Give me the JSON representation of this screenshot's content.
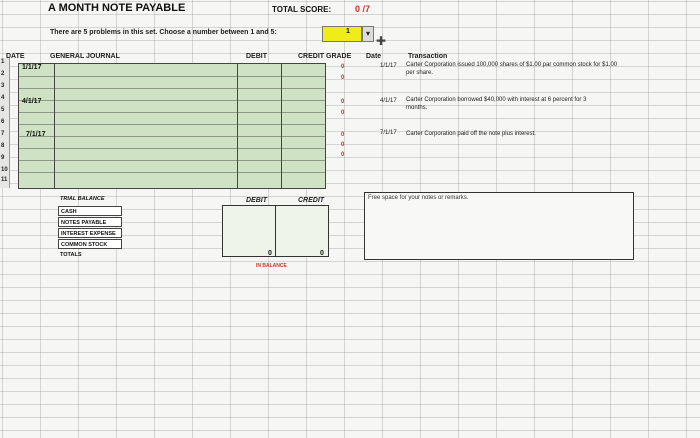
{
  "header": {
    "title": "A MONTH NOTE PAYABLE",
    "total_score_label": "TOTAL SCORE:",
    "total_score_value": "0 /7",
    "instructions": "There are 5 problems in this set. Choose a number between 1 and 5:",
    "problem_selected": "1"
  },
  "journal": {
    "col_date": "DATE",
    "col_journal": "GENERAL JOURNAL",
    "col_debit": "DEBIT",
    "col_credit": "CREDIT",
    "col_grade": "GRADE",
    "entry_dates": [
      "1/1/17",
      "4/1/17",
      "7/1/17"
    ],
    "grades": [
      "0",
      "0",
      "0",
      "0",
      "0",
      "0",
      "0"
    ]
  },
  "row_numbers": [
    "1",
    "2",
    "3",
    "4",
    "5",
    "6",
    "7",
    "8",
    "9",
    "10",
    "11"
  ],
  "transactions": {
    "col_date": "Date",
    "col_transaction": "Transaction",
    "items": [
      {
        "date": "1/1/17",
        "text": "Carter Corporation issued 100,000 shares of $1.00 par common stock for $1.00 per share."
      },
      {
        "date": "4/1/17",
        "text": "Carter Corporation borrowed $40,000 with interest at 6 percent for 3 months."
      },
      {
        "date": "7/1/17",
        "text": "Carter Corporation paid off the note plus interest."
      }
    ]
  },
  "trial_balance": {
    "title": "TRIAL BALANCE",
    "accounts": [
      "CASH",
      "NOTES PAYABLE",
      "INTEREST EXPENSE",
      "COMMON STOCK",
      "TOTALS"
    ],
    "col_debit": "DEBIT",
    "col_credit": "CREDIT",
    "debit_total": "0",
    "credit_total": "0",
    "balance_status": "IN BALANCE"
  },
  "notes": {
    "placeholder": "Free space for your notes or remarks."
  },
  "colors": {
    "journal_fill": "#cfe2c4",
    "selector_fill": "#f0ec1a",
    "grade_red": "#c0392b"
  }
}
